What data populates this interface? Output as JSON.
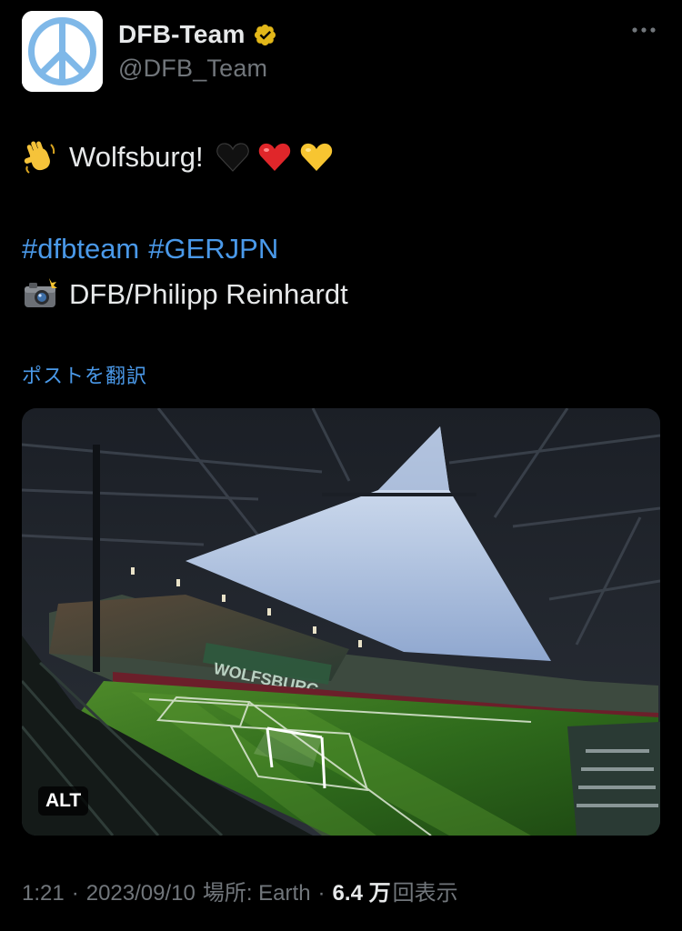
{
  "author": {
    "display_name": "DFB-Team",
    "handle": "@DFB_Team",
    "verified": true,
    "verified_color": "#e2b719",
    "avatar_icon": "peace-sign-icon",
    "avatar_color": "#7fb8e8"
  },
  "tweet": {
    "line1": {
      "emoji": "waving-hand-emoji",
      "text": "Wolfsburg!",
      "hearts": [
        "black-heart-emoji",
        "red-heart-emoji",
        "yellow-heart-emoji"
      ]
    },
    "hashtags": [
      "#dfbteam",
      "#GERJPN"
    ],
    "credit": {
      "emoji": "camera-flash-emoji",
      "text": "DFB/Philipp Reinhardt"
    },
    "translate_label": "ポストを翻訳",
    "link_color": "#4a99e9"
  },
  "media": {
    "alt_label": "ALT",
    "subject": "stadium-photo"
  },
  "meta": {
    "time": "1:21",
    "date": "2023/09/10",
    "location": "場所: Earth",
    "views_count": "6.4 万",
    "views_label": "回表示",
    "separator": "·"
  }
}
